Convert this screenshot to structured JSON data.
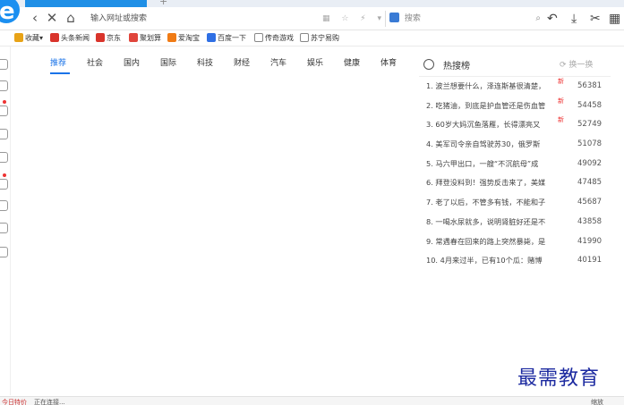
{
  "tabbar": {
    "new_tab_symbol": "+"
  },
  "addressbar": {
    "back": "‹",
    "stop": "✕",
    "home": "⌂",
    "url_placeholder": "输入网址或搜索",
    "url_tool_icons": "▦ ☆ ⚡ ▾",
    "search_placeholder": "搜索",
    "search_icon": "⌕",
    "undo": "↶",
    "download": "⤓",
    "cut": "✂",
    "grid": "▦"
  },
  "bookmarks": [
    {
      "label": "收藏",
      "arrow": "▾",
      "color": "#e8a317"
    },
    {
      "label": "头条新闻",
      "color": "#d9342b"
    },
    {
      "label": "京东",
      "color": "#d9342b"
    },
    {
      "label": "聚划算",
      "color": "#e0453b"
    },
    {
      "label": "爱淘宝",
      "color": "#f07b15"
    },
    {
      "label": "百度一下",
      "color": "#2f6fe4"
    },
    {
      "label": "传奇游戏",
      "color": "#888888"
    },
    {
      "label": "苏宁易购",
      "color": "#888888"
    }
  ],
  "channels": [
    "推荐",
    "社会",
    "国内",
    "国际",
    "科技",
    "财经",
    "汽车",
    "娱乐",
    "健康",
    "体育"
  ],
  "hot_search": {
    "title": "热搜榜",
    "refresh": "换一换",
    "items": [
      {
        "rank": "1.",
        "text": "波兰想要什么，泽连斯基很清楚，",
        "new": "新",
        "count": "56381"
      },
      {
        "rank": "2.",
        "text": "吃猪油，到底是护血管还是伤血管",
        "new": "新",
        "count": "54458"
      },
      {
        "rank": "3.",
        "text": "60岁大妈沉鱼落雁，长得漂亮又",
        "new": "新",
        "count": "52749"
      },
      {
        "rank": "4.",
        "text": "美军司令亲自驾驶苏30，俄罗斯",
        "new": "",
        "count": "51078"
      },
      {
        "rank": "5.",
        "text": "马六甲出口，一艘“不沉航母”成",
        "new": "",
        "count": "49092"
      },
      {
        "rank": "6.",
        "text": "拜登没料到！强势反击来了，美媒",
        "new": "",
        "count": "47485"
      },
      {
        "rank": "7.",
        "text": "老了以后，不管多有钱，不能和子",
        "new": "",
        "count": "45687"
      },
      {
        "rank": "8.",
        "text": "一喝水尿就多，说明肾脏好还是不",
        "new": "",
        "count": "43858"
      },
      {
        "rank": "9.",
        "text": "常遇春在回来的路上突然暴毙，是",
        "new": "",
        "count": "41990"
      },
      {
        "rank": "10.",
        "text": "4月来过半，已有10个瓜：赌博",
        "new": "",
        "count": "40191"
      }
    ]
  },
  "watermark": "最需教育",
  "statusbar": {
    "left_red": "今日特价",
    "left": "正在连接...",
    "zoom": "缩放(100%)"
  },
  "colors": {
    "accent": "#1a73e8",
    "new_badge": "#e33333",
    "logo": "#1b8ff0",
    "watermark": "#1c2aa0"
  }
}
